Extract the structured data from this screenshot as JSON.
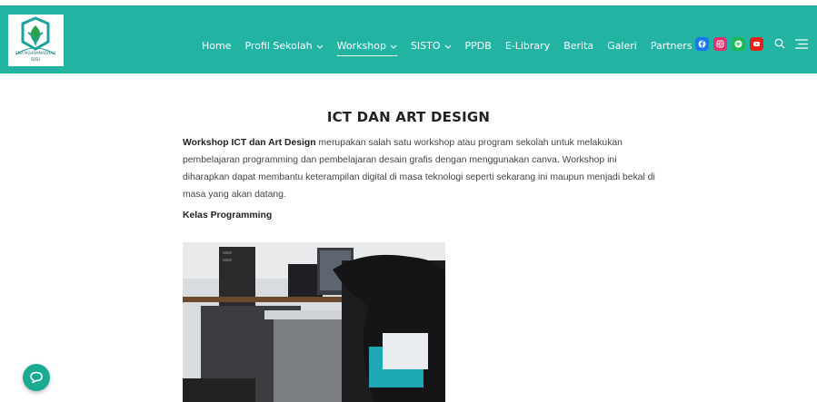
{
  "header": {
    "logo_text_top": "SMA MUHAMMADIYAH",
    "logo_text_bottom": "SIGI",
    "nav": [
      {
        "label": "Home",
        "dropdown": false,
        "active": false
      },
      {
        "label": "Profil Sekolah",
        "dropdown": true,
        "active": false
      },
      {
        "label": "Workshop",
        "dropdown": true,
        "active": true
      },
      {
        "label": "SISTO",
        "dropdown": true,
        "active": false
      },
      {
        "label": "PPDB",
        "dropdown": false,
        "active": false
      },
      {
        "label": "E-Library",
        "dropdown": false,
        "active": false
      },
      {
        "label": "Berita",
        "dropdown": false,
        "active": false
      },
      {
        "label": "Galeri",
        "dropdown": false,
        "active": false
      },
      {
        "label": "Partners",
        "dropdown": true,
        "active": false
      }
    ],
    "social": [
      {
        "name": "facebook-icon",
        "color": "#1877f2"
      },
      {
        "name": "instagram-icon",
        "color": "#e1306c"
      },
      {
        "name": "spotify-icon",
        "color": "#1db954"
      },
      {
        "name": "youtube-icon",
        "color": "#e62117"
      }
    ],
    "bg_color": "#22b3a3"
  },
  "article": {
    "title": "ICT DAN ART DESIGN",
    "intro_bold": "Workshop ICT dan Art Design",
    "intro_rest": " merupakan salah satu workshop atau program sekolah untuk melakukan pembelajaran programming dan pembelajaran desain grafis dengan menggunakan canva. Workshop ini diharapkan dapat membantu keterampilan digital di masa teknologi seperti sekarang ini maupun menjadi bekal di masa yang akan datang.",
    "subheading": "Kelas Programming"
  },
  "chat_button": {
    "color": "#1aaa8f"
  }
}
